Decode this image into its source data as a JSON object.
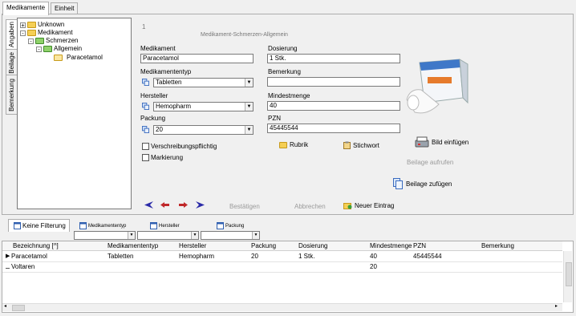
{
  "tabs": [
    {
      "label": "Medikamente"
    },
    {
      "label": "Einheit"
    }
  ],
  "side_tabs": [
    {
      "label": "Angaben"
    },
    {
      "label": "Beilage"
    },
    {
      "label": "Bemerkung"
    }
  ],
  "tree": {
    "nodes": [
      {
        "label": "Unknown",
        "toggle": "+"
      },
      {
        "label": "Medikament",
        "toggle": "-"
      },
      {
        "label": "Schmerzen",
        "toggle": "-"
      },
      {
        "label": "Allgemein",
        "toggle": "-"
      },
      {
        "label": "Paracetamol",
        "toggle": ""
      }
    ]
  },
  "form": {
    "record_number": "1",
    "header": "Medikament-Schmerzen-Allgemein",
    "medikament": {
      "label": "Medikament",
      "value": "Paracetamol"
    },
    "dosierung": {
      "label": "Dosierung",
      "value": "1 Stk."
    },
    "medikamententyp": {
      "label": "Medikamententyp",
      "value": "Tabletten"
    },
    "bemerkung": {
      "label": "Bemerkung",
      "value": ""
    },
    "hersteller": {
      "label": "Hersteller",
      "value": "Hemopharm"
    },
    "mindestmenge": {
      "label": "Mindestmenge",
      "value": "40"
    },
    "packung": {
      "label": "Packung",
      "value": "20"
    },
    "pzn": {
      "label": "PZN",
      "value": "45445544"
    },
    "verschreibungspflichtig": {
      "label": "Verschreibungspflichtig",
      "checked": false
    },
    "markierung": {
      "label": "Markierung",
      "checked": false
    },
    "rubrik_label": "Rubrik",
    "stichwort_label": "Stichwort",
    "bild_einfuegen_label": "Bild einfügen",
    "beilage_aufrufen_label": "Beilage aufrufen",
    "beilage_zufuegen_label": "Beilage zufügen",
    "bestaetigen_label": "Bestätigen",
    "abbrechen_label": "Abbrechen",
    "neuer_eintrag_label": "Neuer Eintrag"
  },
  "filter": {
    "tabs": [
      {
        "label": "Keine Filterung"
      },
      {
        "label": "Medikamententyp"
      },
      {
        "label": "Hersteller"
      },
      {
        "label": "Packung"
      }
    ]
  },
  "table": {
    "columns": [
      "Bezeichnung [^]",
      "Medikamententyp",
      "Hersteller",
      "Packung",
      "Dosierung",
      "Mindestmenge",
      "PZN",
      "Bemerkung"
    ],
    "rows": [
      {
        "indicator": "▶",
        "cells": [
          "Paracetamol",
          "Tabletten",
          "Hemopharm",
          "20",
          "1 Stk.",
          "40",
          "45445544",
          ""
        ]
      },
      {
        "indicator": "",
        "cells": [
          "Voltaren",
          "",
          "",
          "",
          "",
          "20",
          "",
          ""
        ]
      }
    ]
  },
  "colors": {
    "accent": "#1f3fb4",
    "nav_red": "#c0282a",
    "nav_blue": "#2b2ba8"
  }
}
